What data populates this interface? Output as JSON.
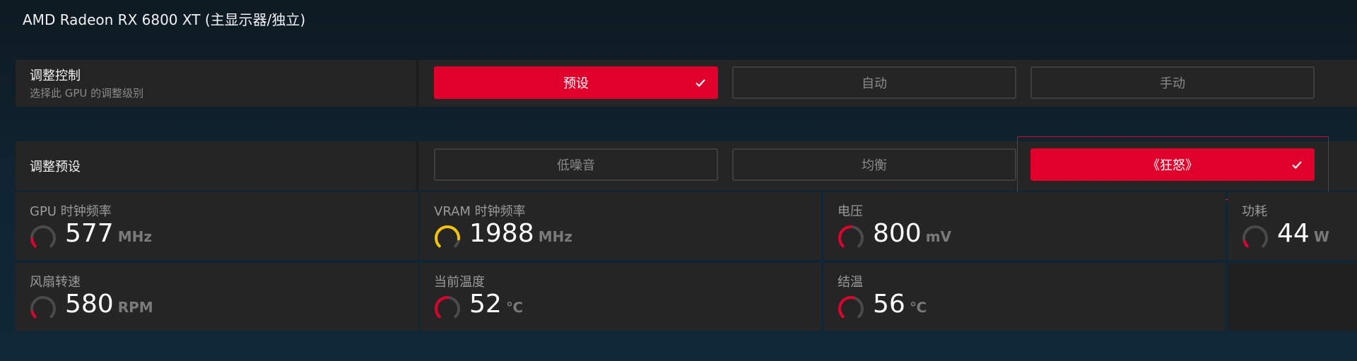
{
  "gpu_title": "AMD Radeon RX 6800 XT (主显示器/独立)",
  "tuning_control": {
    "title": "调整控制",
    "subtitle": "选择此 GPU 的调整级别",
    "options": [
      "预设",
      "自动",
      "手动"
    ],
    "selected": "预设"
  },
  "tuning_preset": {
    "title": "调整预设",
    "options": [
      "低噪音",
      "均衡",
      "《狂怒》"
    ],
    "selected": "《狂怒》"
  },
  "metrics": [
    {
      "label": "GPU 时钟频率",
      "value": "577",
      "unit": "MHz",
      "gauge_fill": 0.15,
      "gauge_color": "#e0002b"
    },
    {
      "label": "VRAM 时钟频率",
      "value": "1988",
      "unit": "MHz",
      "gauge_fill": 0.85,
      "gauge_color": "#f5c400"
    },
    {
      "label": "电压",
      "value": "800",
      "unit": "mV",
      "gauge_fill": 0.5,
      "gauge_color": "#e0002b"
    },
    {
      "label": "功耗",
      "value": "44",
      "unit": "W",
      "gauge_fill": 0.1,
      "gauge_color": "#e0002b"
    },
    {
      "label": "风扇转速",
      "value": "580",
      "unit": "RPM",
      "gauge_fill": 0.1,
      "gauge_color": "#e0002b"
    },
    {
      "label": "当前温度",
      "value": "52",
      "unit": "℃",
      "gauge_fill": 0.5,
      "gauge_color": "#e0002b"
    },
    {
      "label": "结温",
      "value": "56",
      "unit": "℃",
      "gauge_fill": 0.55,
      "gauge_color": "#e0002b"
    }
  ],
  "colors": {
    "accent": "#e0002b",
    "gauge_track": "#4a4a4c",
    "panel": "#252526"
  },
  "icons": {
    "selected_check": "check-icon"
  }
}
